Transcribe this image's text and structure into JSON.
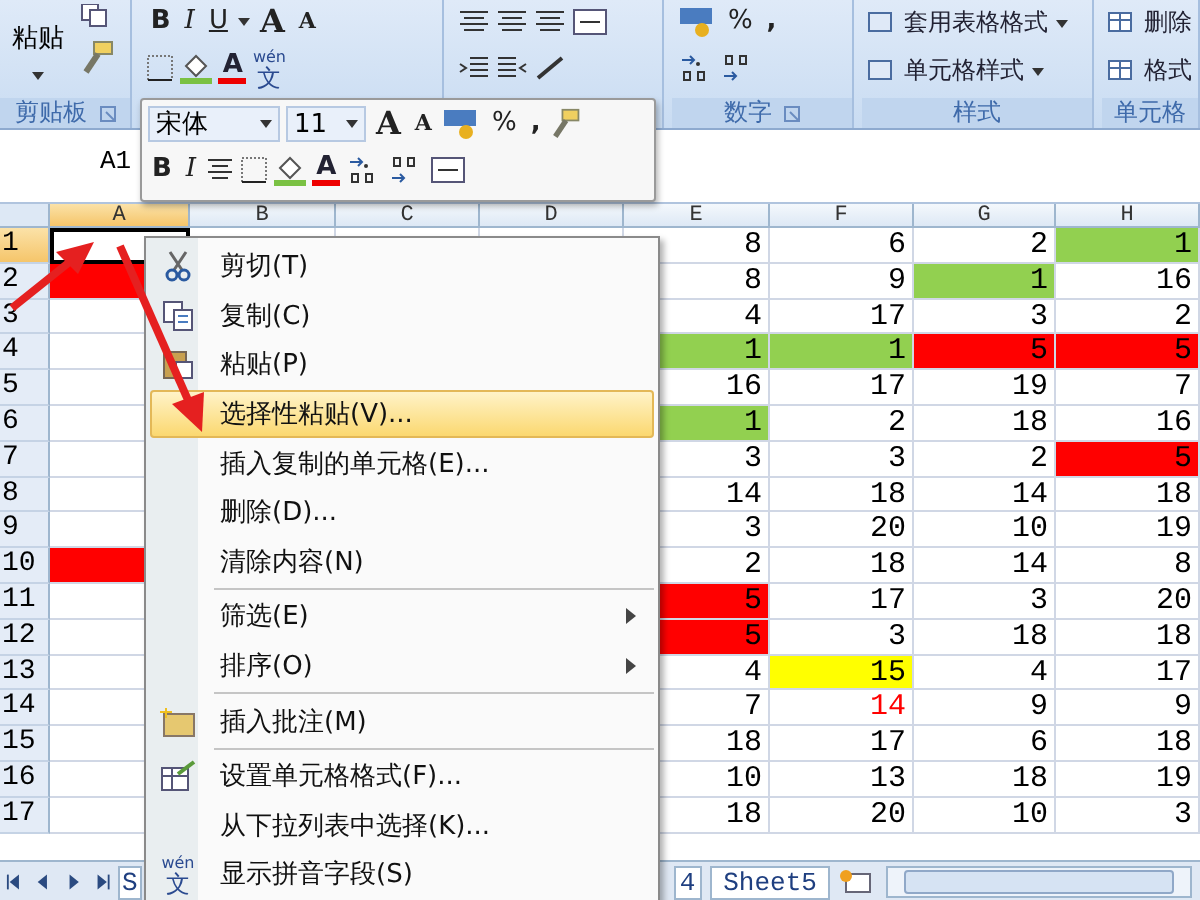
{
  "ribbon": {
    "clipboard": {
      "paste": "粘贴",
      "label": "剪贴板"
    },
    "font": {
      "bold": "B",
      "italic": "I",
      "underline": "U",
      "grow": "A",
      "shrink": "A",
      "font_color": "A",
      "phonetic": [
        "wén",
        "文"
      ]
    },
    "number": {
      "percent": "%",
      "comma": ",",
      "label": "数字"
    },
    "styles": {
      "items": [
        "套用表格格式",
        "单元格样式"
      ],
      "label": "样式"
    },
    "cells": {
      "items": [
        "删除",
        "格式"
      ],
      "label": "单元格"
    }
  },
  "formula_bar": {
    "name_box": "A1"
  },
  "mini_toolbar": {
    "font": "宋体",
    "size": "11",
    "grow": "A",
    "shrink": "A",
    "percent": "%",
    "comma": ",",
    "bold": "B",
    "italic": "I",
    "font_color": "A"
  },
  "sheet": {
    "columns": [
      {
        "label": "A",
        "selected": true
      },
      {
        "label": "B",
        "selected": false
      },
      {
        "label": "C",
        "selected": false
      },
      {
        "label": "D",
        "selected": false
      },
      {
        "label": "E",
        "selected": false
      },
      {
        "label": "F",
        "selected": false
      },
      {
        "label": "G",
        "selected": false
      },
      {
        "label": "H",
        "selected": false
      }
    ],
    "rows": [
      {
        "label": "1",
        "selected": true,
        "cells": [
          {
            "text": "8"
          },
          {
            "text": "6"
          },
          {
            "text": "2"
          },
          {
            "text": "1",
            "color": "#92d050"
          }
        ]
      },
      {
        "label": "2",
        "selected": false,
        "col_a": {
          "color": "#ff0000"
        },
        "cells": [
          {
            "text": "8"
          },
          {
            "text": "9"
          },
          {
            "text": "1",
            "color": "#92d050"
          },
          {
            "text": "16"
          }
        ]
      },
      {
        "label": "3",
        "selected": false,
        "cells": [
          {
            "text": "4"
          },
          {
            "text": "17"
          },
          {
            "text": "3"
          },
          {
            "text": "2"
          }
        ]
      },
      {
        "label": "4",
        "selected": false,
        "cells": [
          {
            "text": "1",
            "color": "#92d050"
          },
          {
            "text": "1",
            "color": "#92d050"
          },
          {
            "text": "5",
            "color": "#ff0000"
          },
          {
            "text": "5",
            "color": "#ff0000"
          }
        ]
      },
      {
        "label": "5",
        "selected": false,
        "cells": [
          {
            "text": "16"
          },
          {
            "text": "17"
          },
          {
            "text": "19"
          },
          {
            "text": "7"
          }
        ]
      },
      {
        "label": "6",
        "selected": false,
        "cells": [
          {
            "text": "1",
            "color": "#92d050"
          },
          {
            "text": "2"
          },
          {
            "text": "18"
          },
          {
            "text": "16"
          }
        ]
      },
      {
        "label": "7",
        "selected": false,
        "cells": [
          {
            "text": "3"
          },
          {
            "text": "3"
          },
          {
            "text": "2"
          },
          {
            "text": "5",
            "color": "#ff0000"
          }
        ]
      },
      {
        "label": "8",
        "selected": false,
        "cells": [
          {
            "text": "14"
          },
          {
            "text": "18"
          },
          {
            "text": "14"
          },
          {
            "text": "18"
          }
        ]
      },
      {
        "label": "9",
        "selected": false,
        "cells": [
          {
            "text": "3"
          },
          {
            "text": "20"
          },
          {
            "text": "10"
          },
          {
            "text": "19"
          }
        ]
      },
      {
        "label": "10",
        "selected": false,
        "col_a": {
          "color": "#ff0000"
        },
        "cells": [
          {
            "text": "2"
          },
          {
            "text": "18"
          },
          {
            "text": "14"
          },
          {
            "text": "8"
          }
        ]
      },
      {
        "label": "11",
        "selected": false,
        "cells": [
          {
            "text": "5",
            "color": "#ff0000"
          },
          {
            "text": "17"
          },
          {
            "text": "3"
          },
          {
            "text": "20"
          }
        ]
      },
      {
        "label": "12",
        "selected": false,
        "cells": [
          {
            "text": "5",
            "color": "#ff0000"
          },
          {
            "text": "3"
          },
          {
            "text": "18"
          },
          {
            "text": "18"
          }
        ]
      },
      {
        "label": "13",
        "selected": false,
        "cells": [
          {
            "text": "4"
          },
          {
            "text": "15",
            "color": "#ffff00"
          },
          {
            "text": "4"
          },
          {
            "text": "17"
          }
        ]
      },
      {
        "label": "14",
        "selected": false,
        "cells": [
          {
            "text": "7"
          },
          {
            "text": "14",
            "color": "#ff0000",
            "kind": "text"
          },
          {
            "text": "9"
          },
          {
            "text": "9"
          }
        ]
      },
      {
        "label": "15",
        "selected": false,
        "cells": [
          {
            "text": "18"
          },
          {
            "text": "17"
          },
          {
            "text": "6"
          },
          {
            "text": "18"
          }
        ]
      },
      {
        "label": "16",
        "selected": false,
        "cells": [
          {
            "text": "10"
          },
          {
            "text": "13"
          },
          {
            "text": "18"
          },
          {
            "text": "19"
          }
        ]
      },
      {
        "label": "17",
        "selected": false,
        "cells": [
          {
            "text": "18"
          },
          {
            "text": "20"
          },
          {
            "text": "10"
          },
          {
            "text": "3"
          }
        ]
      }
    ]
  },
  "context_menu": {
    "groups": [
      [
        {
          "label": "剪切(T)",
          "kind": "scissors",
          "selected": false
        },
        {
          "label": "复制(C)",
          "kind": "copy",
          "selected": false
        },
        {
          "label": "粘贴(P)",
          "kind": "paste",
          "selected": false
        },
        {
          "label": "选择性粘贴(V)...",
          "selected": true
        },
        {
          "label": "插入复制的单元格(E)...",
          "selected": false
        },
        {
          "label": "删除(D)...",
          "selected": false
        },
        {
          "label": "清除内容(N)",
          "selected": false
        }
      ],
      [
        {
          "label": "筛选(E)",
          "submenu": true,
          "selected": false
        },
        {
          "label": "排序(O)",
          "submenu": true,
          "selected": false
        }
      ],
      [
        {
          "label": "插入批注(M)",
          "kind": "comment",
          "selected": false
        }
      ],
      [
        {
          "label": "设置单元格格式(F)...",
          "kind": "format",
          "selected": false
        },
        {
          "label": "从下拉列表中选择(K)...",
          "selected": false
        },
        {
          "label": "显示拼音字段(S)",
          "kind": "phonetic",
          "icon_text": [
            "wén",
            "文"
          ],
          "selected": false
        }
      ]
    ]
  },
  "sheet_tabs": [
    {
      "label": "S"
    },
    {
      "label": "4"
    },
    {
      "label": "Sheet5"
    }
  ]
}
